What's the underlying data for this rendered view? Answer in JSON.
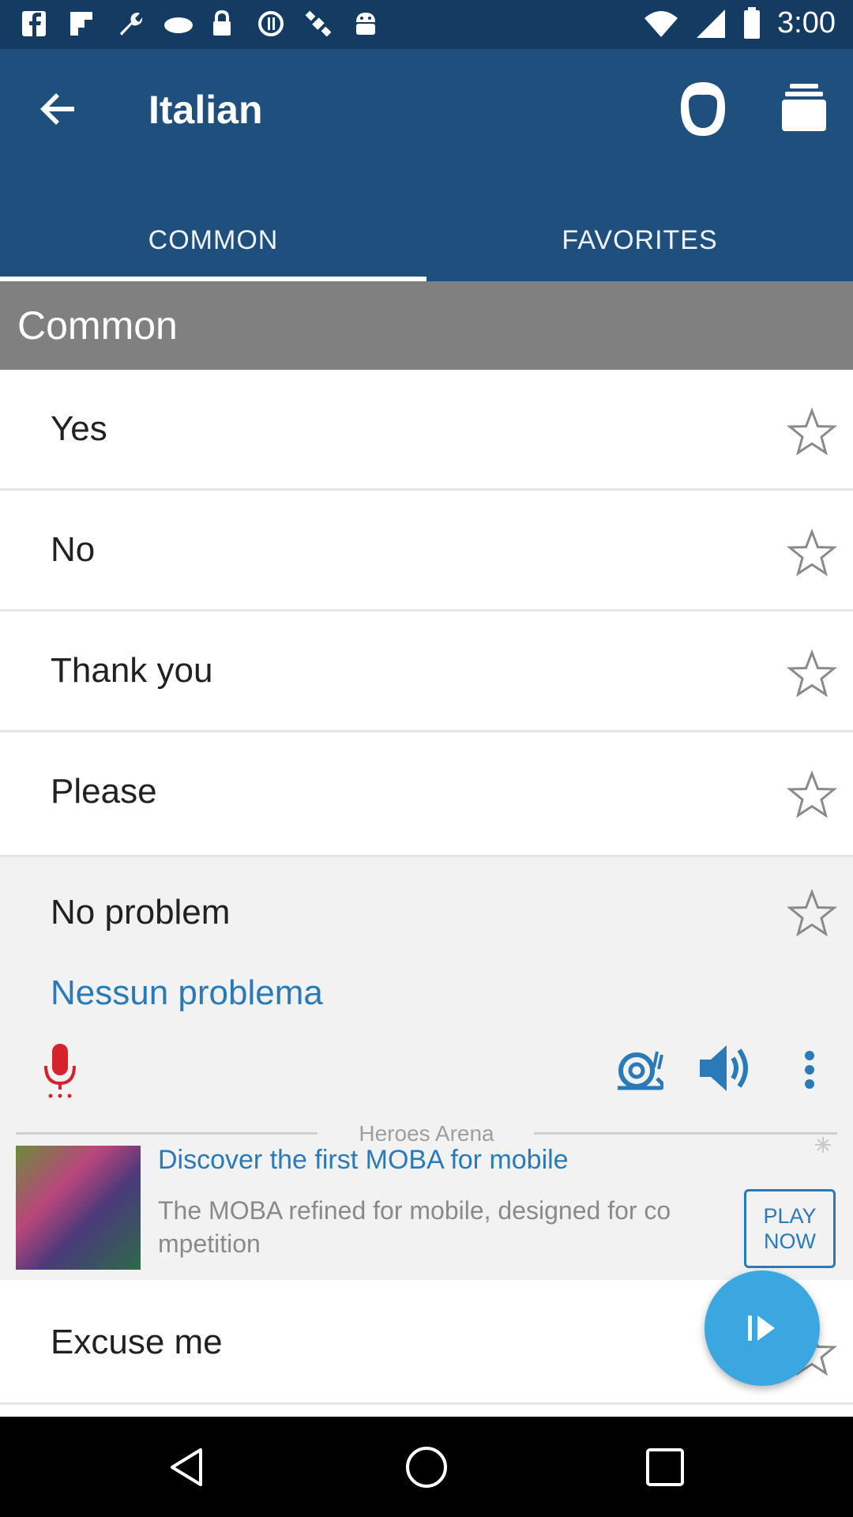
{
  "status_bar": {
    "time": "3:00",
    "left_icons": [
      "facebook-icon",
      "flipboard-icon",
      "wrench-icon",
      "cloud-icon",
      "lock-icon",
      "blocked-icon",
      "satellite-icon",
      "android-icon"
    ],
    "right_icons": [
      "wifi-icon",
      "signal-icon",
      "battery-icon"
    ]
  },
  "app_bar": {
    "title": "Italian",
    "tabs": [
      {
        "label": "COMMON",
        "selected": true
      },
      {
        "label": "FAVORITES",
        "selected": false
      }
    ]
  },
  "section_header": "Common",
  "phrases": [
    {
      "label": "Yes"
    },
    {
      "label": "No"
    },
    {
      "label": "Thank you"
    },
    {
      "label": "Please"
    }
  ],
  "expanded_phrase": {
    "label": "No problem",
    "translation": "Nessun problema",
    "actions": [
      "mic-icon",
      "snail-icon",
      "speaker-icon",
      "more-icon"
    ]
  },
  "ad": {
    "brand": "Heroes Arena",
    "headline": "Discover the first MOBA for mobile",
    "body": "The MOBA refined for mobile, designed for co mpetition",
    "cta": "PLAY NOW"
  },
  "last_phrase": {
    "label": "Excuse me"
  },
  "colors": {
    "primary": "#1e4f7d",
    "status_bar": "#143c62",
    "accent": "#2a7ab8",
    "fab": "#3aa7e0",
    "section_bg": "#808080"
  }
}
